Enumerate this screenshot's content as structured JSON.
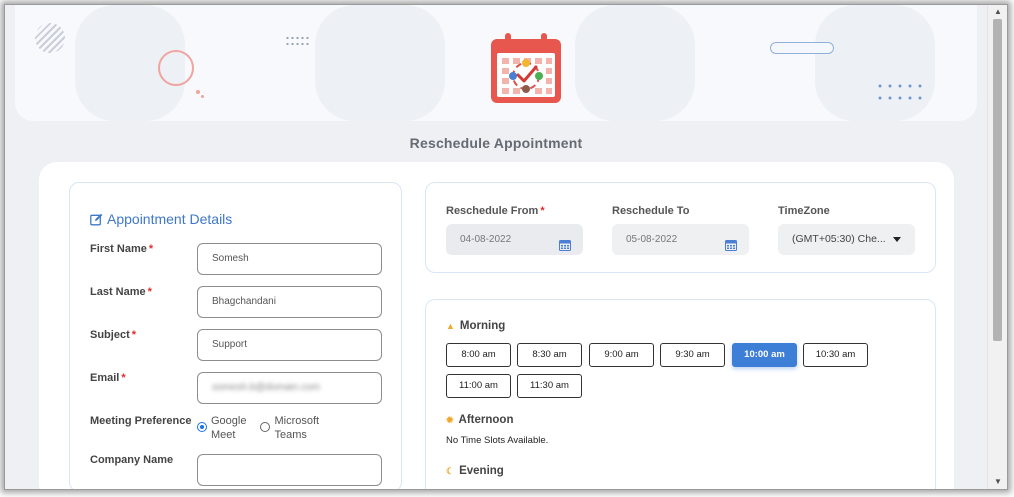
{
  "page": {
    "title": "Reschedule Appointment"
  },
  "details": {
    "heading": "Appointment Details",
    "fields": [
      {
        "label": "First Name",
        "required": "*",
        "value": "Somesh"
      },
      {
        "label": "Last Name",
        "required": "*",
        "value": "Bhagchandani"
      },
      {
        "label": "Subject",
        "required": "*",
        "value": "Support"
      },
      {
        "label": "Email",
        "required": "*",
        "value": "somesh.b@domain.com"
      },
      {
        "label": "Company Name",
        "value": ""
      }
    ],
    "meeting_preference": {
      "label": "Meeting Preference",
      "options": [
        {
          "line1": "Google",
          "line2": "Meet",
          "checked": true
        },
        {
          "line1": "Microsoft",
          "line2": "Teams",
          "checked": false
        }
      ]
    }
  },
  "reschedule": {
    "from_label": "Reschedule From",
    "from_required": "*",
    "from_value": "04-08-2022",
    "to_label": "Reschedule To",
    "to_value": "05-08-2022",
    "timezone_label": "TimeZone",
    "timezone_value": "(GMT+05:30) Che..."
  },
  "slots": {
    "morning_label": "Morning",
    "morning_times": [
      "8:00 am",
      "8:30 am",
      "9:00 am",
      "9:30 am",
      "10:00 am",
      "10:30 am",
      "11:00 am",
      "11:30 am"
    ],
    "selected": "10:00 am",
    "afternoon_label": "Afternoon",
    "afternoon_message": "No Time Slots Available.",
    "evening_label": "Evening"
  },
  "colors": {
    "accent": "#3d7fd6",
    "calendar_icon": "#e8574d",
    "required": "#e02c2c"
  },
  "icons": {
    "header": "calendar-check-icon",
    "details": "edit-icon",
    "date": "calendar-icon",
    "morning": "sunrise-icon",
    "afternoon": "sun-icon",
    "evening": "moon-icon"
  }
}
